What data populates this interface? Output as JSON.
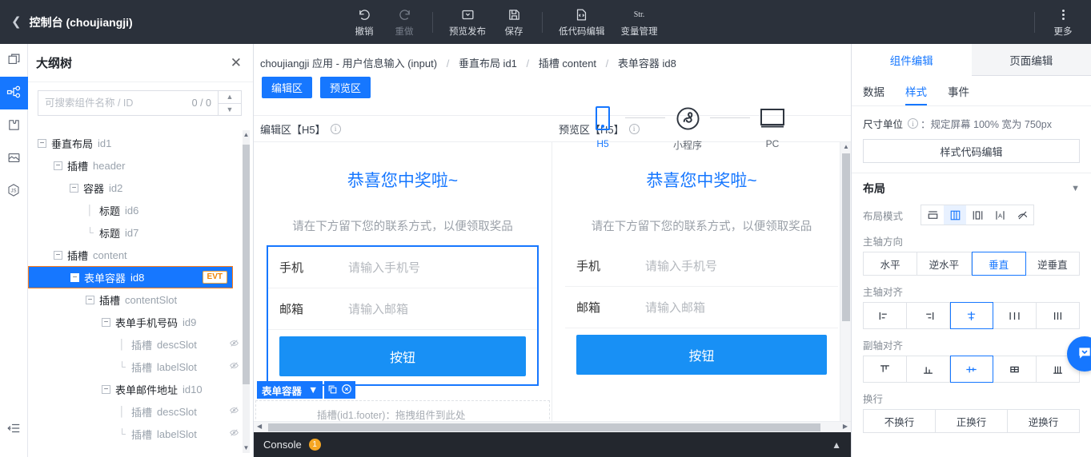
{
  "topbar": {
    "back_icon": "chevron-left",
    "title": "控制台 (choujiangji)",
    "tools": [
      {
        "label": "撤销",
        "icon": "undo-icon",
        "disabled": false
      },
      {
        "label": "重做",
        "icon": "redo-icon",
        "disabled": true
      },
      {
        "label": "预览发布",
        "icon": "preview-publish-icon",
        "disabled": false
      },
      {
        "label": "保存",
        "icon": "save-icon",
        "disabled": false
      },
      {
        "label": "低代码编辑",
        "icon": "code-file-icon",
        "disabled": false
      },
      {
        "label": "变量管理",
        "icon": "str-icon",
        "glyph": "Str.",
        "disabled": false
      }
    ],
    "more_label": "更多"
  },
  "rail": {
    "items": [
      {
        "name": "pages-icon"
      },
      {
        "name": "outline-tree-icon"
      },
      {
        "name": "components-icon"
      },
      {
        "name": "assets-icon"
      },
      {
        "name": "js-icon"
      }
    ],
    "collapse_icon": "collapse-icon"
  },
  "outline": {
    "title": "大纲树",
    "close_icon": "close-icon",
    "search": {
      "placeholder": "可搜索组件名称 / ID",
      "value": "",
      "count": "0 / 0"
    },
    "tree": [
      {
        "indent": 0,
        "toggle": "-",
        "label": "垂直布局",
        "id": "id1",
        "selected": false
      },
      {
        "indent": 1,
        "toggle": "-",
        "label": "插槽",
        "id": "header",
        "selected": false,
        "muted_id": true
      },
      {
        "indent": 2,
        "toggle": "-",
        "label": "容器",
        "id": "id2",
        "selected": false
      },
      {
        "indent": 3,
        "toggle": "leaf",
        "label": "标题",
        "id": "id6",
        "selected": false
      },
      {
        "indent": 3,
        "toggle": "leaf-last",
        "label": "标题",
        "id": "id7",
        "selected": false
      },
      {
        "indent": 1,
        "toggle": "-",
        "label": "插槽",
        "id": "content",
        "selected": false
      },
      {
        "indent": 2,
        "toggle": "-",
        "label": "表单容器",
        "id": "id8",
        "selected": true,
        "badge": "EVT"
      },
      {
        "indent": 3,
        "toggle": "-",
        "label": "插槽",
        "id": "contentSlot",
        "selected": false
      },
      {
        "indent": 4,
        "toggle": "-",
        "label": "表单手机号码",
        "id": "id9",
        "selected": false
      },
      {
        "indent": 5,
        "toggle": "leaf",
        "label": "插槽",
        "id": "descSlot",
        "selected": false,
        "muted": true,
        "eye": true
      },
      {
        "indent": 5,
        "toggle": "leaf-last",
        "label": "插槽",
        "id": "labelSlot",
        "selected": false,
        "muted": true,
        "eye": true
      },
      {
        "indent": 4,
        "toggle": "-",
        "label": "表单邮件地址",
        "id": "id10",
        "selected": false
      },
      {
        "indent": 5,
        "toggle": "leaf",
        "label": "插槽",
        "id": "descSlot",
        "selected": false,
        "muted": true,
        "eye": true
      },
      {
        "indent": 5,
        "toggle": "leaf-last",
        "label": "插槽",
        "id": "labelSlot",
        "selected": false,
        "muted": true,
        "eye": true
      }
    ]
  },
  "center": {
    "breadcrumb": {
      "root": "choujiangji 应用 - 用户信息输入 (input)",
      "items": [
        "垂直布局 id1",
        "插槽 content",
        "表单容器 id8"
      ]
    },
    "buttons": {
      "edit_area": "编辑区",
      "preview_area": "预览区"
    },
    "devices": [
      {
        "label": "H5",
        "icon": "phone-icon",
        "active": true
      },
      {
        "label": "小程序",
        "icon": "miniprogram-icon",
        "active": false
      },
      {
        "label": "PC",
        "icon": "monitor-icon",
        "active": false
      }
    ],
    "area_heads": {
      "edit": "编辑区【H5】",
      "preview": "预览区【H5】",
      "info_icon": "info-icon"
    },
    "phone_content": {
      "title": "恭喜您中奖啦~",
      "subtitle": "请在下方留下您的联系方式，以便领取奖品",
      "fields": [
        {
          "label": "手机",
          "placeholder": "请输入手机号"
        },
        {
          "label": "邮箱",
          "placeholder": "请输入邮箱"
        }
      ],
      "button": "按钮"
    },
    "float_tag": {
      "name": "表单容器",
      "caret_icon": "chevron-down-icon",
      "copy_icon": "copy-icon",
      "delete_icon": "delete-circle-icon"
    },
    "drop_hint": "插槽(id1.footer)：拖拽组件到此处",
    "console": {
      "label": "Console",
      "count": "1",
      "chevron_icon": "chevron-up-icon"
    }
  },
  "right": {
    "tabs": [
      {
        "label": "组件编辑",
        "active": true
      },
      {
        "label": "页面编辑",
        "active": false
      }
    ],
    "sub_tabs": [
      {
        "label": "数据",
        "active": false
      },
      {
        "label": "样式",
        "active": true
      },
      {
        "label": "事件",
        "active": false
      }
    ],
    "unit_row": {
      "label": "尺寸单位",
      "info_icon": "info-icon",
      "value": "：规定屏幕 100% 宽为 750px"
    },
    "style_code_button": "样式代码编辑",
    "layout_section": {
      "title": "布局",
      "chevron_icon": "chevron-down-icon",
      "mode_label": "布局模式",
      "modes": [
        {
          "name": "block-icon",
          "active": false
        },
        {
          "name": "flex-icon",
          "active": true
        },
        {
          "name": "inline-flex-icon",
          "active": false
        },
        {
          "name": "inline-icon",
          "active": false
        },
        {
          "name": "none-icon",
          "active": false
        }
      ],
      "main_axis_label": "主轴方向",
      "main_axis_options": [
        {
          "label": "水平",
          "active": false
        },
        {
          "label": "逆水平",
          "active": false
        },
        {
          "label": "垂直",
          "active": true
        },
        {
          "label": "逆垂直",
          "active": false
        }
      ],
      "main_align_label": "主轴对齐",
      "main_align_options": [
        {
          "name": "justify-start-icon",
          "active": false
        },
        {
          "name": "justify-end-icon",
          "active": false
        },
        {
          "name": "justify-center-icon",
          "active": true
        },
        {
          "name": "justify-between-icon",
          "active": false
        },
        {
          "name": "justify-around-icon",
          "active": false
        }
      ],
      "cross_align_label": "副轴对齐",
      "cross_align_options": [
        {
          "name": "align-start-icon",
          "active": false
        },
        {
          "name": "align-end-icon",
          "active": false
        },
        {
          "name": "align-center-icon",
          "active": true
        },
        {
          "name": "align-baseline-icon",
          "active": false
        },
        {
          "name": "align-stretch-icon",
          "active": false
        }
      ],
      "wrap_label": "换行",
      "wrap_options": [
        {
          "label": "不换行",
          "active": false
        },
        {
          "label": "正换行",
          "active": false
        },
        {
          "label": "逆换行",
          "active": false
        }
      ]
    },
    "fab_icon": "chat-icon"
  },
  "colors": {
    "accent": "#1677ff",
    "topbar": "#2b313b",
    "badge": "#f5a623",
    "evt": "#f08200"
  }
}
